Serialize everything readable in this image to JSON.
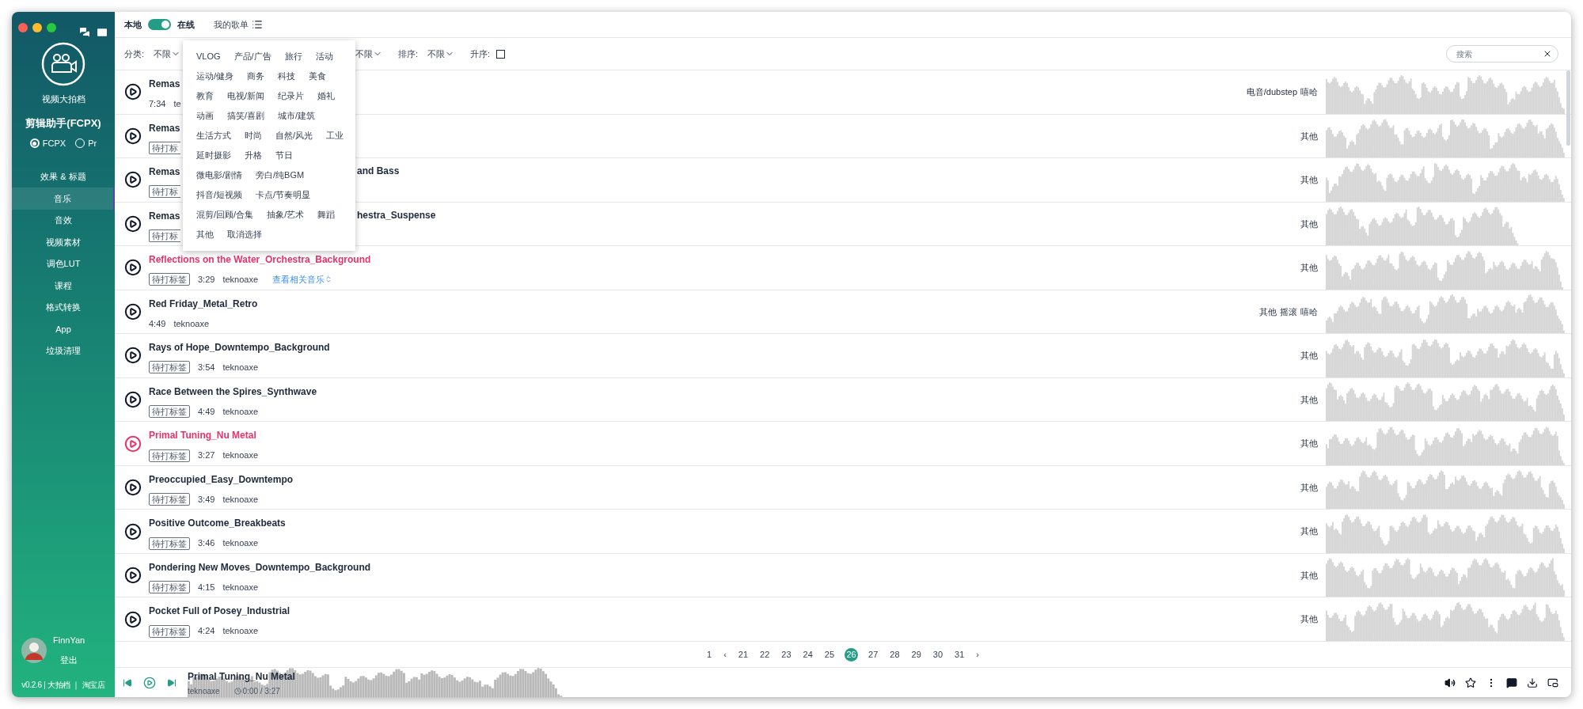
{
  "sidebar": {
    "brand_caption": "视频大拍档",
    "app_title": "剪辑助手(FCPX)",
    "modes": [
      {
        "label": "FCPX",
        "selected": true
      },
      {
        "label": "Pr",
        "selected": false
      }
    ],
    "nav": [
      {
        "label": "效果 & 标题",
        "selected": false
      },
      {
        "label": "音乐",
        "selected": true
      },
      {
        "label": "音效",
        "selected": false
      },
      {
        "label": "视频素材",
        "selected": false
      },
      {
        "label": "调色LUT",
        "selected": false
      },
      {
        "label": "课程",
        "selected": false
      },
      {
        "label": "格式转换",
        "selected": false
      },
      {
        "label": "App",
        "selected": false
      },
      {
        "label": "垃圾清理",
        "selected": false
      }
    ],
    "user": {
      "name": "FinnYan",
      "logout": "登出"
    },
    "footer": "v0.2.6 | 大拍档 ｜ 淘宝店"
  },
  "top_bar": {
    "local_label": "本地",
    "online": true,
    "online_label": "在线",
    "playlist_label": "我的歌单"
  },
  "filters": {
    "category_label": "分类:",
    "category_value": "不限",
    "hidden_filter_value": "不限",
    "sort_label": "排序:",
    "sort_value": "不限",
    "ascending_label": "升序:",
    "ascending": false,
    "search_placeholder": "搜索"
  },
  "category_menu": [
    [
      "VLOG",
      "产品/广告",
      "旅行",
      "活动"
    ],
    [
      "运动/健身",
      "商务",
      "科技",
      "美食"
    ],
    [
      "教育",
      "电视/新闻",
      "纪录片",
      "婚礼"
    ],
    [
      "动画",
      "搞笑/喜剧",
      "城市/建筑"
    ],
    [
      "生活方式",
      "时尚",
      "自然/风光",
      "工业"
    ],
    [
      "延时摄影",
      "升格",
      "节日"
    ],
    [
      "微电影/剧情",
      "旁白/纯BGM"
    ],
    [
      "抖音/短视频",
      "卡点/节奏明显"
    ],
    [
      "混剪/回顾/合集",
      "抽象/艺术",
      "舞蹈"
    ],
    [
      "其他",
      "取消选择"
    ]
  ],
  "tracks": [
    {
      "title": "Remas",
      "highlighted": false,
      "playing": false,
      "duration": "7:34",
      "artist": "te",
      "genres": [
        "电音/dubstep",
        "嘻哈"
      ]
    },
    {
      "title": "Remas",
      "highlighted": false,
      "playing": false,
      "tag": "待打标",
      "genres": [
        "其他"
      ]
    },
    {
      "title": "Remas",
      "title_tail": "and Bass",
      "highlighted": false,
      "playing": false,
      "tag": "待打标",
      "genres": [
        "其他"
      ]
    },
    {
      "title": "Remas",
      "title_tail": "hestra_Suspense",
      "highlighted": false,
      "playing": false,
      "tag": "待打标",
      "genres": [
        "其他"
      ]
    },
    {
      "title": "Reflections on the Water_Orchestra_Background",
      "highlighted": true,
      "playing": false,
      "tag": "待打标签",
      "duration": "3:29",
      "artist": "teknoaxe",
      "link": "查看相关音乐",
      "genres": [
        "其他"
      ]
    },
    {
      "title": "Red Friday_Metal_Retro",
      "highlighted": false,
      "playing": false,
      "duration": "4:49",
      "artist": "teknoaxe",
      "genres": [
        "其他",
        "摇滚",
        "嘻哈"
      ]
    },
    {
      "title": "Rays of Hope_Downtempo_Background",
      "highlighted": false,
      "playing": false,
      "tag": "待打标签",
      "duration": "3:54",
      "artist": "teknoaxe",
      "genres": [
        "其他"
      ]
    },
    {
      "title": "Race Between the Spires_Synthwave",
      "highlighted": false,
      "playing": false,
      "tag": "待打标签",
      "duration": "4:49",
      "artist": "teknoaxe",
      "genres": [
        "其他"
      ]
    },
    {
      "title": "Primal Tuning_Nu Metal",
      "highlighted": true,
      "playing": true,
      "tag": "待打标签",
      "duration": "3:27",
      "artist": "teknoaxe",
      "genres": [
        "其他"
      ]
    },
    {
      "title": "Preoccupied_Easy_Downtempo",
      "highlighted": false,
      "playing": false,
      "tag": "待打标签",
      "duration": "3:49",
      "artist": "teknoaxe",
      "genres": [
        "其他"
      ]
    },
    {
      "title": "Positive Outcome_Breakbeats",
      "highlighted": false,
      "playing": false,
      "tag": "待打标签",
      "duration": "3:46",
      "artist": "teknoaxe",
      "genres": [
        "其他"
      ]
    },
    {
      "title": "Pondering New Moves_Downtempo_Background",
      "highlighted": false,
      "playing": false,
      "tag": "待打标签",
      "duration": "4:15",
      "artist": "teknoaxe",
      "genres": [
        "其他"
      ]
    },
    {
      "title": "Pocket Full of Posey_Industrial",
      "highlighted": false,
      "playing": false,
      "tag": "待打标签",
      "duration": "4:24",
      "artist": "teknoaxe",
      "genres": [
        "其他"
      ]
    }
  ],
  "pagination": {
    "first": "1",
    "prev": "‹",
    "pages": [
      {
        "label": "21",
        "selected": false
      },
      {
        "label": "22",
        "selected": false
      },
      {
        "label": "23",
        "selected": false
      },
      {
        "label": "24",
        "selected": false
      },
      {
        "label": "25",
        "selected": false
      },
      {
        "label": "26",
        "selected": true
      },
      {
        "label": "27",
        "selected": false
      },
      {
        "label": "28",
        "selected": false
      },
      {
        "label": "29",
        "selected": false
      },
      {
        "label": "30",
        "selected": false
      },
      {
        "label": "31",
        "selected": false
      }
    ],
    "next": "›"
  },
  "player": {
    "title": "Primal Tuning_Nu Metal",
    "artist": "teknoaxe",
    "time": "0:00 / 3:27"
  }
}
